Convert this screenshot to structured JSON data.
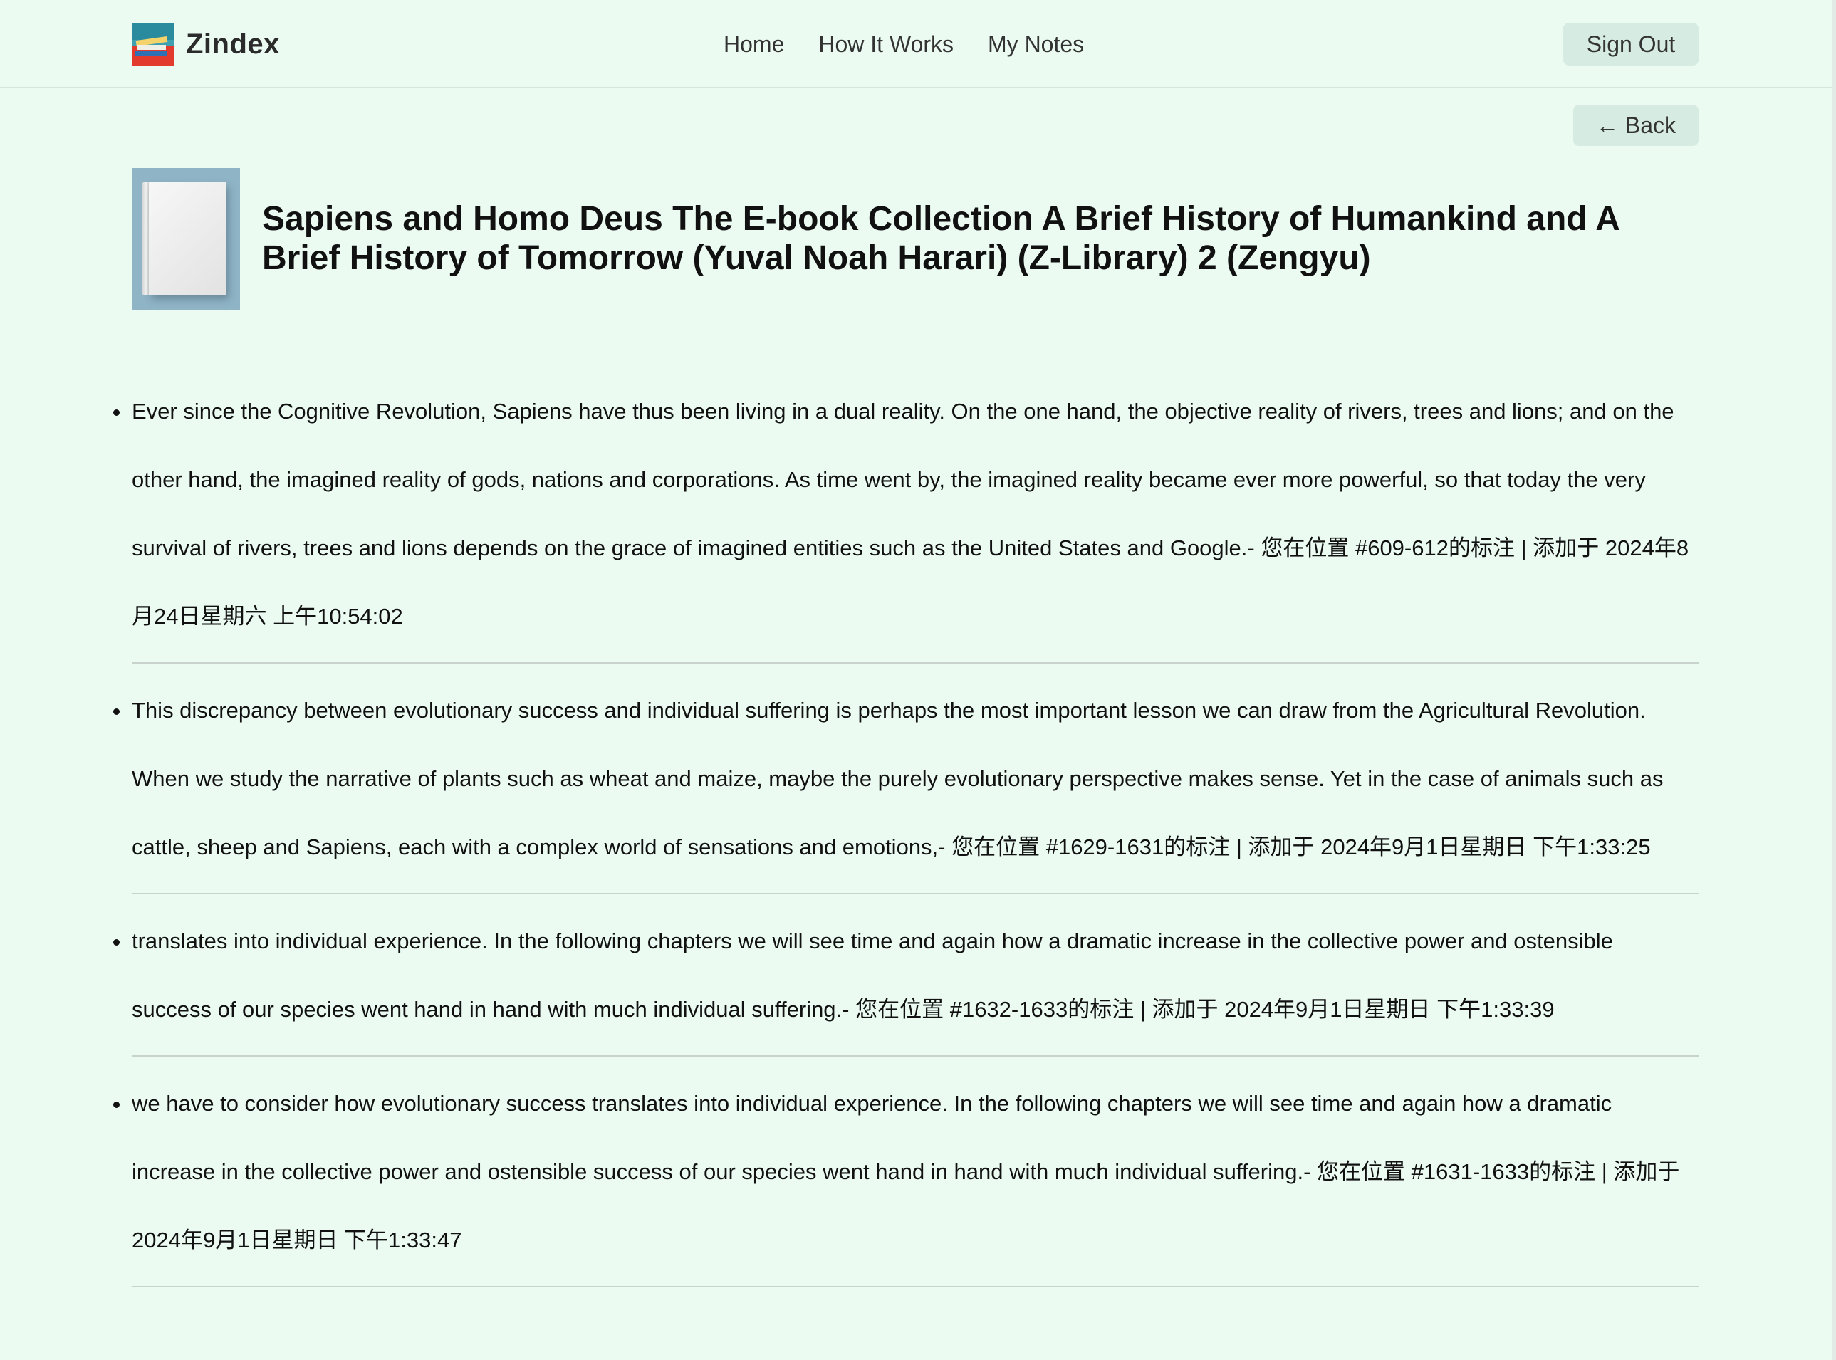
{
  "brand": {
    "name": "Zindex"
  },
  "nav": {
    "items": [
      {
        "label": "Home"
      },
      {
        "label": "How It Works"
      },
      {
        "label": "My Notes"
      }
    ],
    "sign_out_label": "Sign Out"
  },
  "back_label": "← Back",
  "book": {
    "title": "Sapiens and Homo Deus The E-book Collection A Brief History of Humankind and A Brief History of Tomorrow (Yuval Noah Harari) (Z-Library) 2 (Zengyu)"
  },
  "notes": [
    {
      "text": "Ever since the Cognitive Revolution, Sapiens have thus been living in a dual reality. On the one hand, the objective reality of rivers, trees and lions; and on the other hand, the imagined reality of gods, nations and corporations. As time went by, the imagined reality became ever more powerful, so that today the very survival of rivers, trees and lions depends on the grace of imagined entities such as the United States and Google.- 您在位置 #609-612的标注 | 添加于 2024年8月24日星期六 上午10:54:02"
    },
    {
      "text": "This discrepancy between evolutionary success and individual suffering is perhaps the most important lesson we can draw from the Agricultural Revolution. When we study the narrative of plants such as wheat and maize, maybe the purely evolutionary perspective makes sense. Yet in the case of animals such as cattle, sheep and Sapiens, each with a complex world of sensations and emotions,- 您在位置 #1629-1631的标注 | 添加于 2024年9月1日星期日 下午1:33:25"
    },
    {
      "text": "translates into individual experience. In the following chapters we will see time and again how a dramatic increase in the collective power and ostensible success of our species went hand in hand with much individual suffering.- 您在位置 #1632-1633的标注 | 添加于 2024年9月1日星期日 下午1:33:39"
    },
    {
      "text": "we have to consider how evolutionary success translates into individual experience. In the following chapters we will see time and again how a dramatic increase in the collective power and ostensible success of our species went hand in hand with much individual suffering.- 您在位置 #1631-1633的标注 | 添加于 2024年9月1日星期日 下午1:33:47"
    }
  ],
  "icons": {
    "logo": "stacked-books-logo-icon",
    "cover": "book-cover-image"
  }
}
